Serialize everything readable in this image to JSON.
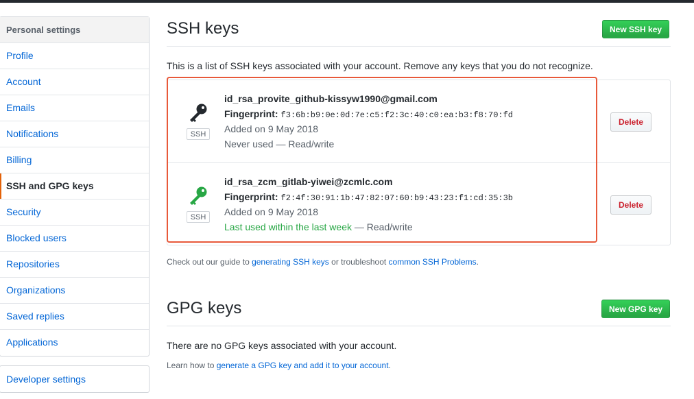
{
  "sidebar": {
    "header": "Personal settings",
    "items": [
      {
        "label": "Profile"
      },
      {
        "label": "Account"
      },
      {
        "label": "Emails"
      },
      {
        "label": "Notifications"
      },
      {
        "label": "Billing"
      },
      {
        "label": "SSH and GPG keys",
        "selected": true
      },
      {
        "label": "Security"
      },
      {
        "label": "Blocked users"
      },
      {
        "label": "Repositories"
      },
      {
        "label": "Organizations"
      },
      {
        "label": "Saved replies"
      },
      {
        "label": "Applications"
      }
    ],
    "developer_settings": "Developer settings"
  },
  "ssh": {
    "title": "SSH keys",
    "new_button": "New SSH key",
    "description": "This is a list of SSH keys associated with your account. Remove any keys that you do not recognize.",
    "keys": [
      {
        "title": "id_rsa_provite_github-kissyw1990@gmail.com",
        "fingerprint_label": "Fingerprint:",
        "fingerprint": "f3:6b:b9:0e:0d:7e:c5:f2:3c:40:c0:ea:b3:f8:70:fd",
        "added": "Added on 9 May 2018",
        "usage": "Never used",
        "access": " — Read/write",
        "badge": "SSH",
        "icon_color": "#24292e",
        "delete_label": "Delete"
      },
      {
        "title": "id_rsa_zcm_gitlab-yiwei@zcmlc.com",
        "fingerprint_label": "Fingerprint:",
        "fingerprint": "f2:4f:30:91:1b:47:82:07:60:b9:43:23:f1:cd:35:3b",
        "added": "Added on 9 May 2018",
        "usage": "Last used within the last week",
        "access": " — Read/write",
        "badge": "SSH",
        "icon_color": "#28a745",
        "delete_label": "Delete"
      }
    ],
    "help_prefix": "Check out our guide to ",
    "help_link1": "generating SSH keys",
    "help_middle": " or troubleshoot ",
    "help_link2": "common SSH Problems",
    "help_suffix": "."
  },
  "gpg": {
    "title": "GPG keys",
    "new_button": "New GPG key",
    "empty": "There are no GPG keys associated with your account.",
    "help_prefix": "Learn how to ",
    "help_link": "generate a GPG key and add it to your account",
    "help_suffix": "."
  },
  "colors": {
    "link": "#0366d6",
    "green": "#28a745",
    "danger": "#cb2431",
    "highlight": "#e8593a"
  }
}
